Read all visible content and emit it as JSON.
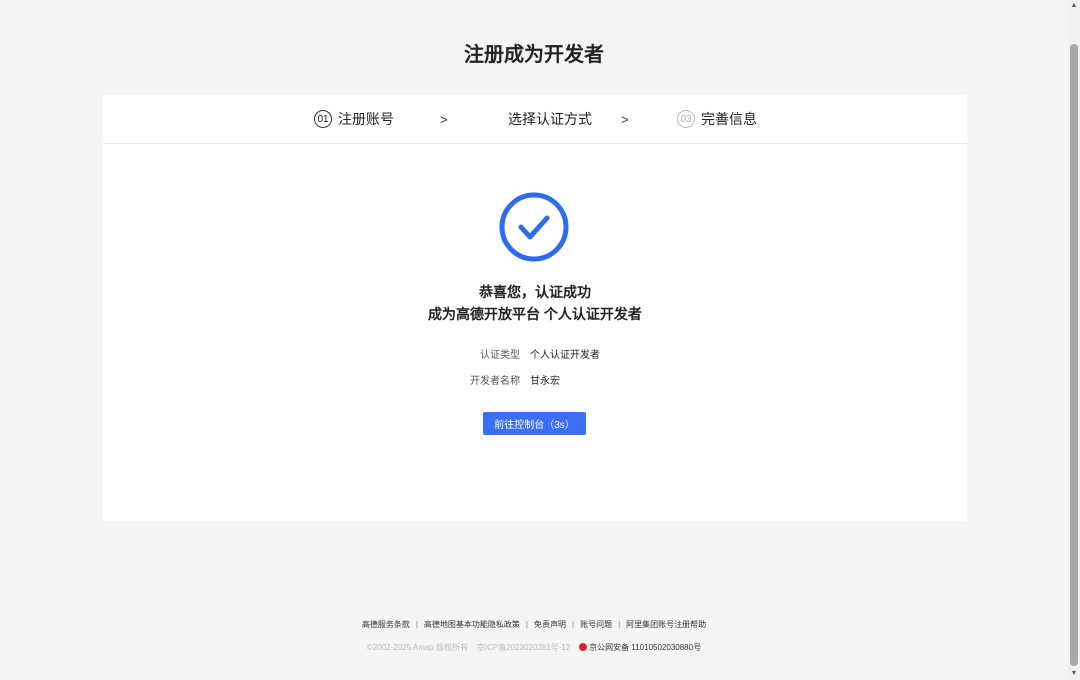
{
  "page": {
    "title": "注册成为开发者"
  },
  "steps": [
    {
      "num": "01",
      "label": "注册账号"
    },
    {
      "num": "",
      "label": "选择认证方式"
    },
    {
      "num": "03",
      "label": "完善信息"
    }
  ],
  "step_separator": ">",
  "result": {
    "line1": "恭喜您，认证成功",
    "line2": "成为高德开放平台 个人认证开发者",
    "icon": "check-circle-icon",
    "accent_color": "#2f6bf0"
  },
  "info": [
    {
      "label": "认证类型",
      "value": "个人认证开发者"
    },
    {
      "label": "开发者名称",
      "value": "甘永宏"
    }
  ],
  "button": {
    "label": "前往控制台（3s）",
    "color": "#3c6ff5"
  },
  "footer": {
    "links": [
      "高德服务条款",
      "高德地图基本功能隐私政策",
      "免责声明",
      "账号问题",
      "阿里集团账号注册帮助"
    ],
    "separator": "|",
    "copyright": "©2002-2025 Amap 版权所有",
    "icp": "京ICP备2023020281号-12",
    "police": "京公网安备 11010502030880号"
  }
}
